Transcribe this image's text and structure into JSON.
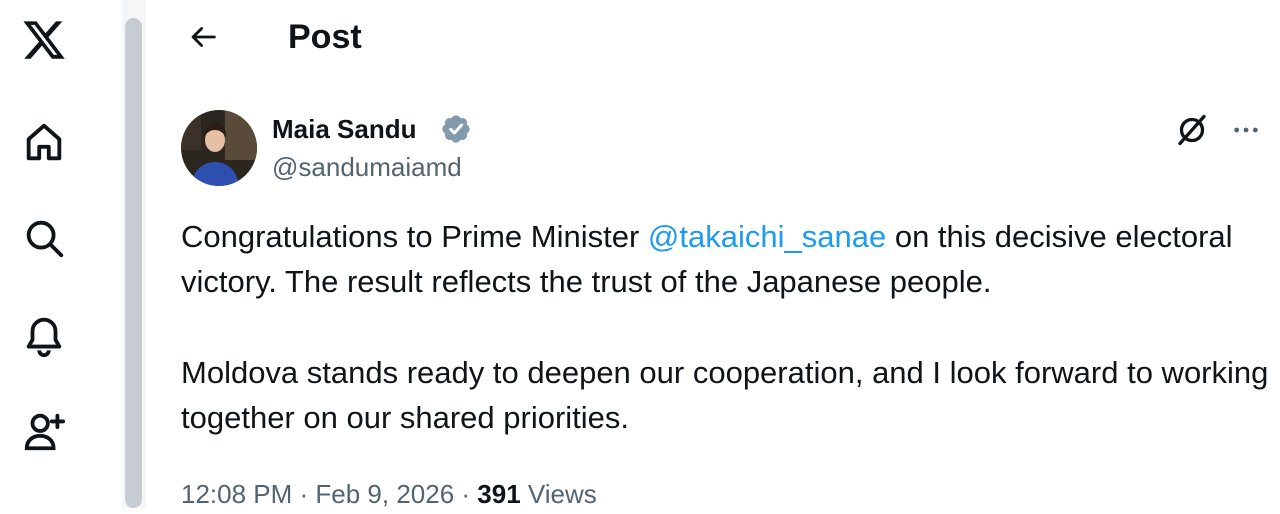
{
  "header": {
    "title": "Post"
  },
  "nav": [
    "x-logo-icon",
    "home-icon",
    "search-icon",
    "bell-icon",
    "follow-icon"
  ],
  "post": {
    "author_name": "Maia Sandu",
    "author_handle": "@sandumaiamd",
    "verified": true,
    "text": {
      "p1_before": "Congratulations to Prime Minister ",
      "p1_mention": "@takaichi_sanae",
      "p1_after": " on this decisive electoral victory. The result reflects the trust of the Japanese people.",
      "p2": "Moldova stands ready to deepen our cooperation, and I look forward to working together on our shared priorities."
    },
    "time": "12:08 PM",
    "separator": " · ",
    "date": "Feb 9, 2026",
    "views_count": "391",
    "views_label": " Views"
  },
  "colors": {
    "accent": "#1d9bf0",
    "text": "#0f1419",
    "muted": "#536471",
    "verified": "#829aab"
  }
}
